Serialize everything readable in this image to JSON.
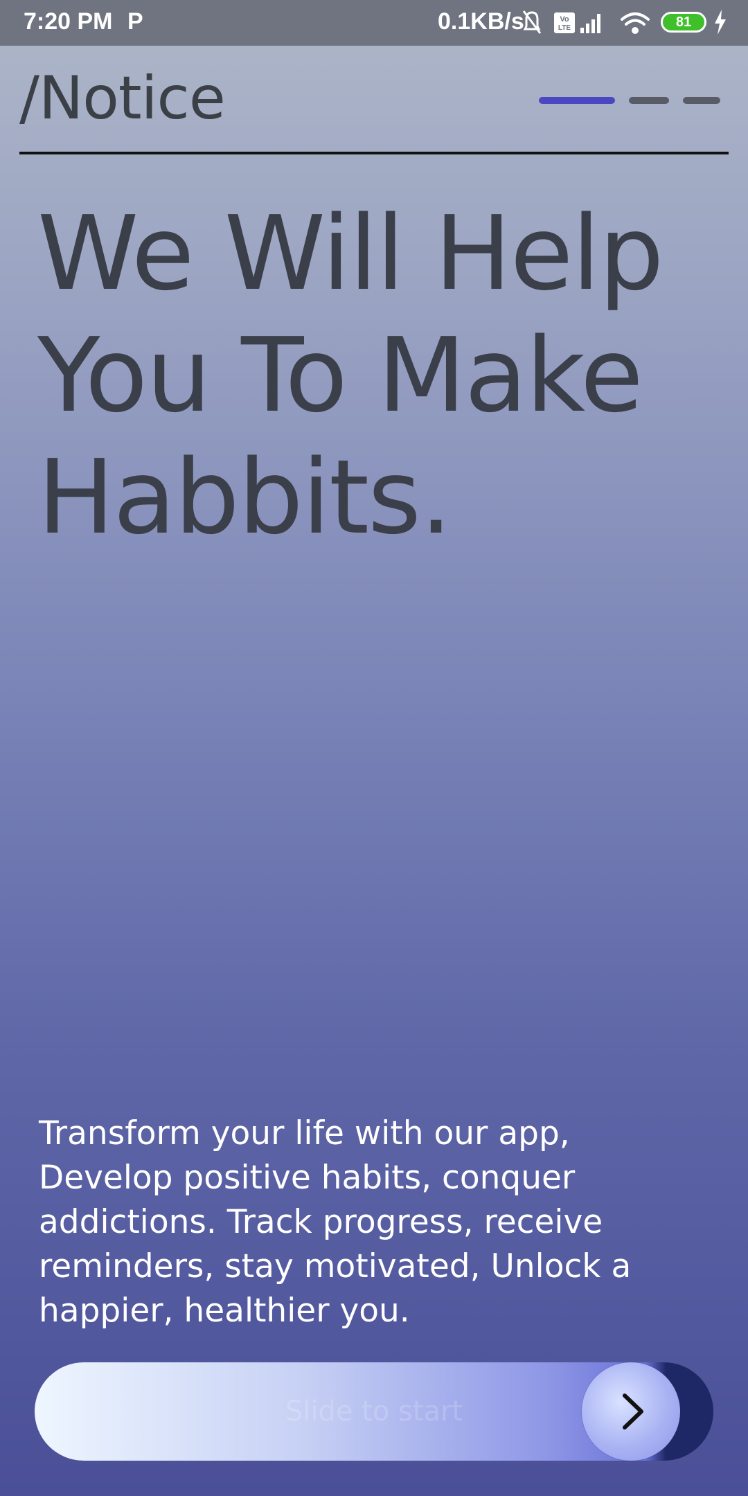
{
  "status_bar": {
    "time": "7:20 PM",
    "app_indicator": "P",
    "network_speed": "0.1KB/s",
    "battery_level": "81",
    "icons": [
      "bell-muted-icon",
      "volte-icon",
      "signal-icon",
      "wifi-icon",
      "battery-icon",
      "charging-icon"
    ]
  },
  "header": {
    "title": "/Notice",
    "page_indicator": {
      "total": 3,
      "active_index": 0
    }
  },
  "hero": {
    "headline_lines": [
      "We Will Help",
      "You To Make",
      "Habbits."
    ]
  },
  "description": {
    "lines": [
      "Transform your life with our app,",
      "Develop positive habits, conquer",
      "addictions. Track progress, receive",
      "reminders, stay motivated, Unlock a",
      "happier, healthier you."
    ]
  },
  "slider": {
    "hint": "Slide to start",
    "knob_icon": "chevron-right-icon"
  },
  "colors": {
    "accent": "#4a47c0",
    "headline": "#3a3f4a",
    "body_text": "#ffffff",
    "slider_dark": "#1f2866"
  }
}
